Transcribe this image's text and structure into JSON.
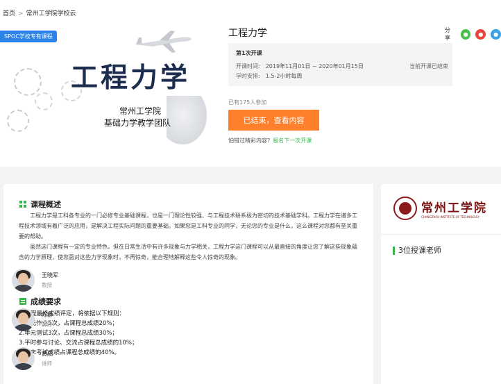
{
  "breadcrumb": {
    "home": "首页",
    "separator": ">",
    "current": "常州工学院学校云"
  },
  "cover": {
    "badge": "SPOC学校专有课程",
    "title": "工程力学",
    "school_line1": "常州工学院",
    "school_line2": "基础力学教学团队"
  },
  "course": {
    "title": "工程力学",
    "share_label": "分享",
    "share_icons": [
      "wechat-icon",
      "weibo-icon",
      "qq-icon"
    ],
    "term": {
      "name": "第1次开课",
      "time_label": "开课时间:",
      "time_value": "2019年11月01日 ~ 2020年01月15日",
      "schedule_label": "学时安排:",
      "schedule_value": "1.5-2小时每周",
      "status": "当前开课已结束"
    },
    "enrolled": "已有175人参加",
    "button": "已结束，查看内容",
    "next_prompt": "怕错过精彩内容?",
    "next_link": "报名下一次开课"
  },
  "overview": {
    "heading": "课程概述",
    "paragraphs": [
      "工程力学是工科各专业的一门必修专业基础课程，也是一门理论性较强、与工程技术联系极为密切的技术基础学科。工程力学在诸多工程技术领域有着广泛的应用，是解决工程实际问题的重要基础。如果您是工科专业的同学，无论您的专业是什么，这么课程对您都有至关重要的帮助。",
      "虽然这门课程有一定的专业特色，但在日常生活中有许多现象与力学相关，工程力学这门课程可以从最直接的角度让您了解这些现象蕴含的力学原理，使您面对这些力学现象时，不再惊奇，能合理地解释这些令人惊奇的现象。"
    ]
  },
  "grading": {
    "heading": "成绩要求",
    "lines": [
      "本课程最终成绩评定，将依据以下规则：",
      "1.单元作业5次，占课程总成绩20%；",
      "2.单元测试3次，占课程总成绩30%；",
      "3.平时参与讨论、交流占课程总成绩的10%；",
      "4.期末考试成绩占课程总成绩的40%。"
    ]
  },
  "sidebar": {
    "logo_cn": "常州工学院",
    "logo_en": "CHANGZHOU INSTITUTE OF TECHNOLOGY",
    "teachers_heading": "3位授课老师",
    "teachers": [
      {
        "name": "王晓军",
        "title": "教授"
      },
      {
        "name": "陈静",
        "title": "讲师"
      },
      {
        "name": "黄成",
        "title": "讲师"
      }
    ]
  },
  "colors": {
    "accent_orange": "#ff7f2a",
    "accent_green": "#39b54a",
    "badge_blue": "#2b82e8",
    "cover_title": "#1d2d4f",
    "logo_red": "#7a1212"
  }
}
